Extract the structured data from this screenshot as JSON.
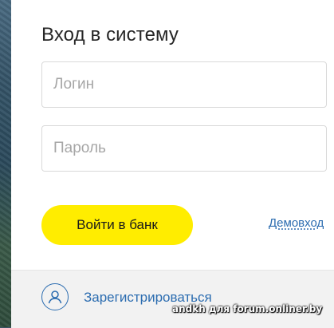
{
  "login_form": {
    "title": "Вход в систему",
    "login_placeholder": "Логин",
    "password_placeholder": "Пароль",
    "submit_label": "Войти в банк",
    "demo_link": "Демовход"
  },
  "footer": {
    "register_icon": "user-icon",
    "register_label": "Зарегистрироваться"
  },
  "watermark": "andkh для forum.onliner.by",
  "colors": {
    "accent_yellow": "#ffed00",
    "link_blue": "#2b6cb0"
  }
}
